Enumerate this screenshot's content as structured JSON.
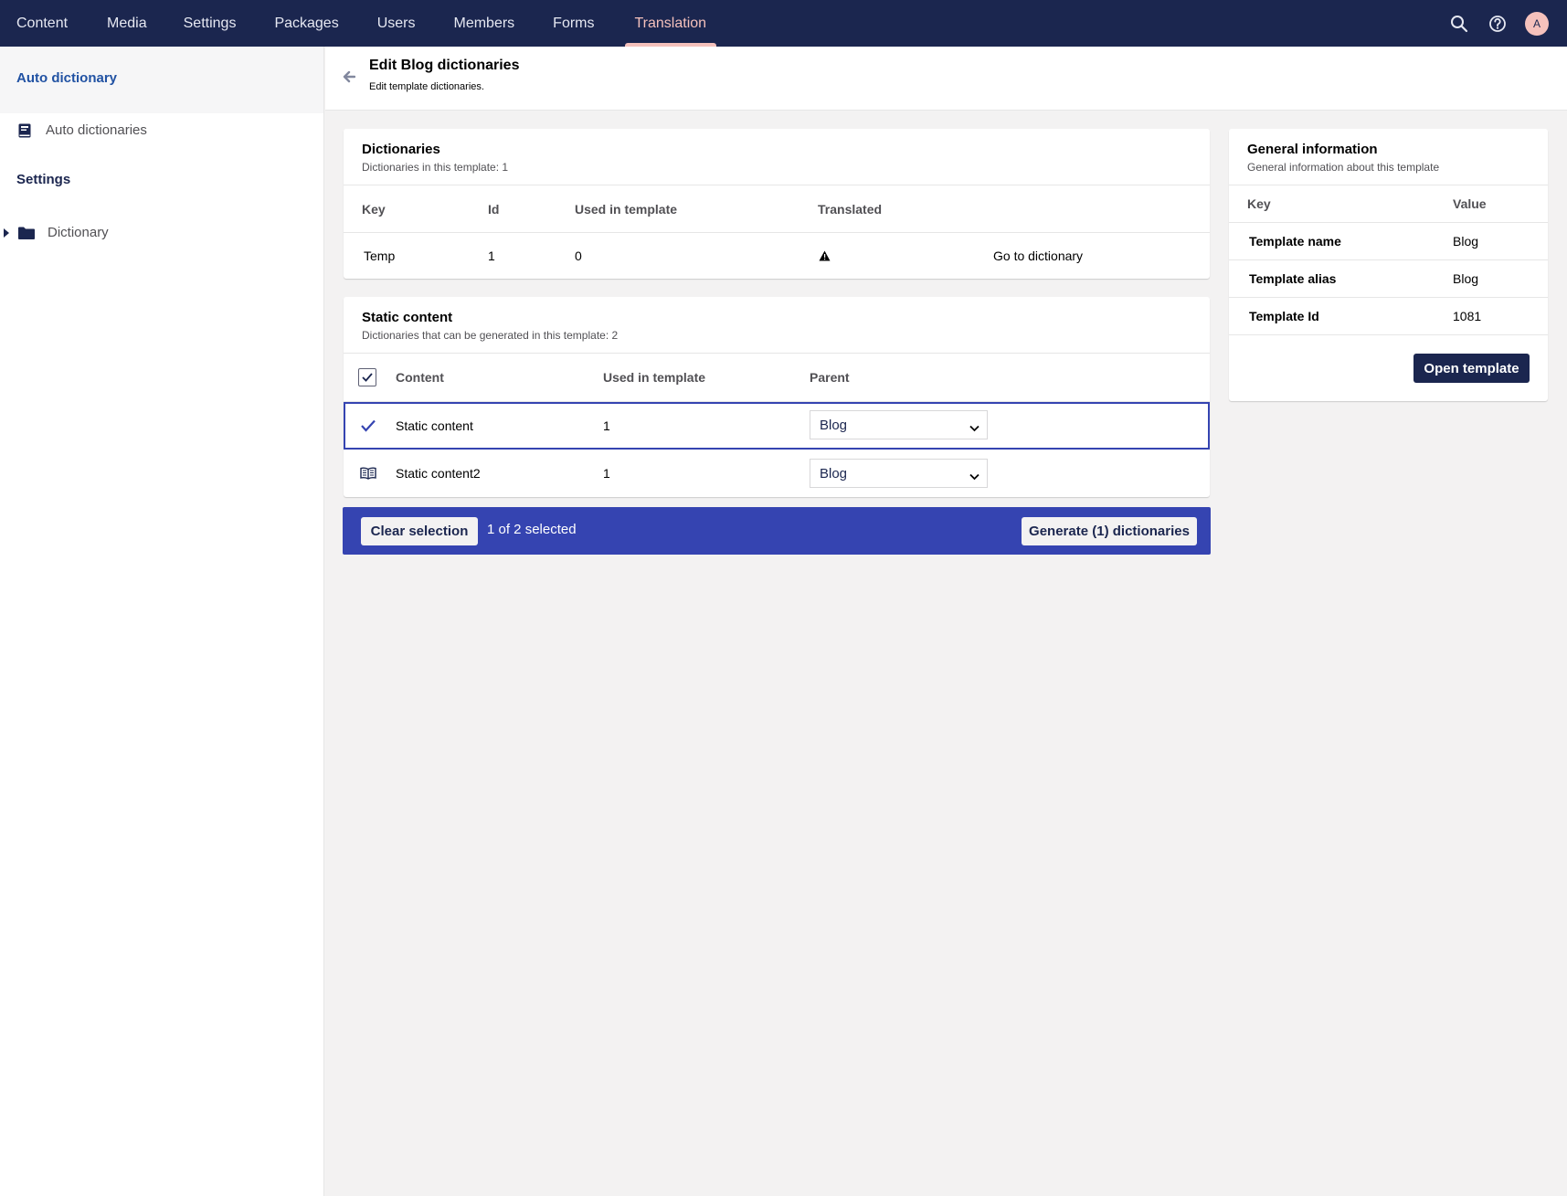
{
  "topnav": {
    "items": [
      {
        "label": "Content"
      },
      {
        "label": "Media"
      },
      {
        "label": "Settings"
      },
      {
        "label": "Packages"
      },
      {
        "label": "Users"
      },
      {
        "label": "Members"
      },
      {
        "label": "Forms"
      },
      {
        "label": "Translation",
        "active": true
      }
    ],
    "avatar_initial": "A",
    "icons": [
      "search-icon",
      "help-icon",
      "avatar"
    ]
  },
  "sidebar": {
    "header": "Auto dictionary",
    "items": [
      {
        "label": "Auto dictionaries",
        "icon": "book-icon"
      }
    ],
    "settings_title": "Settings",
    "settings_items": [
      {
        "label": "Dictionary",
        "icon": "folder-icon"
      }
    ]
  },
  "header": {
    "title": "Edit Blog dictionaries",
    "description": "Edit template dictionaries."
  },
  "dictionaries": {
    "title": "Dictionaries",
    "subtitle": "Dictionaries in this template: 1",
    "columns": [
      "Key",
      "Id",
      "Used in template",
      "Translated"
    ],
    "rows": [
      {
        "key": "Temp",
        "id": "1",
        "used": "0",
        "translated_icon": "warning-icon",
        "link": "Go to dictionary"
      }
    ]
  },
  "static_content": {
    "title": "Static content",
    "subtitle": "Dictionaries that can be generated in this template: 2",
    "columns": [
      "Content",
      "Used in template",
      "Parent"
    ],
    "rows": [
      {
        "content": "Static content",
        "used": "1",
        "parent": "Blog",
        "selected": true
      },
      {
        "content": "Static content2",
        "used": "1",
        "parent": "Blog",
        "selected": false
      }
    ]
  },
  "action_bar": {
    "clear_label": "Clear selection",
    "selected_text": "1 of 2 selected",
    "generate_label": "Generate (1) dictionaries"
  },
  "general_info": {
    "title": "General information",
    "subtitle": "General information about this template",
    "columns": [
      "Key",
      "Value"
    ],
    "rows": [
      {
        "key": "Template name",
        "value": "Blog"
      },
      {
        "key": "Template alias",
        "value": "Blog"
      },
      {
        "key": "Template Id",
        "value": "1081"
      }
    ],
    "open_button": "Open template"
  },
  "colors": {
    "topbar": "#1b264f",
    "active_nav": "#f5c1bc",
    "action_bar": "#3544b1",
    "link_blue": "#2152a3"
  }
}
